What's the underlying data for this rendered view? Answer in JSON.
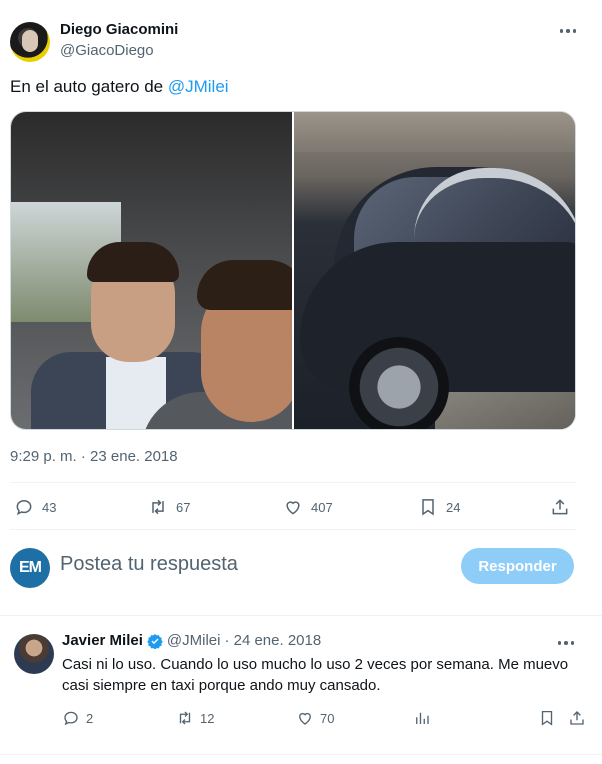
{
  "tweet": {
    "author_name": "Diego Giacomini",
    "author_handle": "@GiacoDiego",
    "text_prefix": "En el auto gatero de ",
    "mention": "@JMilei",
    "timestamp": "9:29 p. m. · 23 ene. 2018",
    "stats": {
      "replies": "43",
      "retweets": "67",
      "likes": "407",
      "bookmarks": "24"
    }
  },
  "reply_composer": {
    "avatar_text": "EM",
    "placeholder": "Postea tu respuesta",
    "button_label": "Responder"
  },
  "reply": {
    "author_name": "Javier Milei",
    "author_handle": "@JMilei",
    "date": "· 24 ene. 2018",
    "text": "Casi ni lo uso. Cuando lo uso mucho lo uso 2 veces por semana. Me muevo casi siempre en taxi porque ando muy cansado.",
    "stats": {
      "replies": "2",
      "retweets": "12",
      "likes": "70"
    }
  },
  "colors": {
    "accent": "#1d9bf0",
    "muted_text": "#536471",
    "button_disabled": "#8ecdf8",
    "divider": "#eff3f4"
  },
  "icons": [
    "more-icon",
    "reply-icon",
    "retweet-icon",
    "like-icon",
    "bookmark-icon",
    "share-icon",
    "analytics-icon",
    "verified-badge-icon"
  ]
}
